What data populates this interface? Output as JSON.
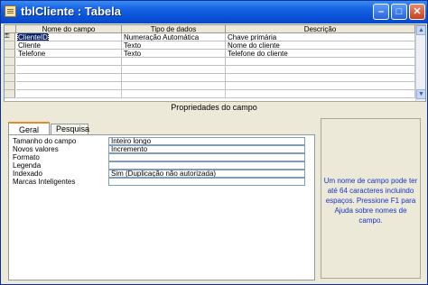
{
  "window": {
    "title": "tblCliente : Tabela",
    "minimize": "–",
    "maximize": "□",
    "close": "✕"
  },
  "grid": {
    "columns": [
      "Nome do campo",
      "Tipo de dados",
      "Descrição"
    ],
    "rows": [
      {
        "name": "ClienteID",
        "type": "Numeração Automática",
        "desc": "Chave primária",
        "key": "⚿"
      },
      {
        "name": "Cliente",
        "type": "Texto",
        "desc": "Nome do cliente"
      },
      {
        "name": "Telefone",
        "type": "Texto",
        "desc": "Telefone do cliente"
      }
    ]
  },
  "properties": {
    "title": "Propriedades do campo",
    "tabs": [
      "Geral",
      "Pesquisa"
    ],
    "items": [
      {
        "label": "Tamanho do campo",
        "value": "Inteiro longo"
      },
      {
        "label": "Novos valores",
        "value": "Incremento"
      },
      {
        "label": "Formato",
        "value": ""
      },
      {
        "label": "Legenda",
        "value": ""
      },
      {
        "label": "Indexado",
        "value": "Sim (Duplicação não autorizada)"
      },
      {
        "label": "Marcas Inteligentes",
        "value": ""
      }
    ],
    "help": "Um nome de campo pode ter até 64 caracteres incluindo espaços. Pressione F1 para Ajuda sobre nomes de campo."
  }
}
